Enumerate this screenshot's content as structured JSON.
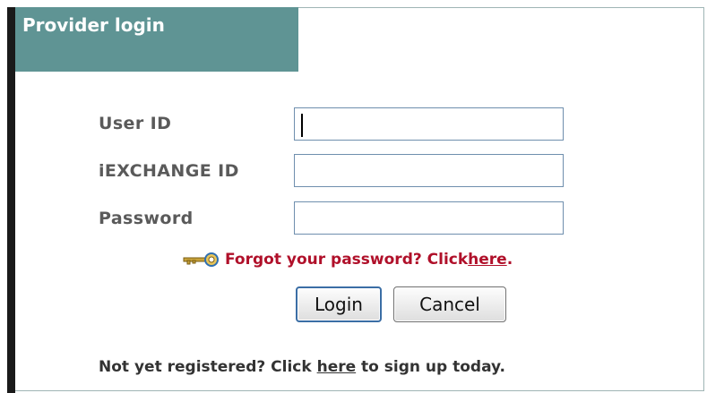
{
  "header": {
    "title": "Provider login"
  },
  "form": {
    "user_id": {
      "label": "User ID",
      "value": "",
      "placeholder": ""
    },
    "iexchange_id": {
      "label": "iEXCHANGE ID",
      "value": "",
      "placeholder": ""
    },
    "password": {
      "label": "Password",
      "value": "",
      "placeholder": ""
    }
  },
  "forgot": {
    "icon": "key-icon",
    "text": "Forgot your password? Click ",
    "link": "here",
    "suffix": "."
  },
  "buttons": {
    "login": "Login",
    "cancel": "Cancel"
  },
  "register": {
    "prefix": "Not yet registered? Click ",
    "link": "here",
    "suffix": " to sign up today."
  },
  "colors": {
    "header_bg": "#5f9494",
    "accent_red": "#b0102a",
    "field_border": "#6f8fae"
  }
}
